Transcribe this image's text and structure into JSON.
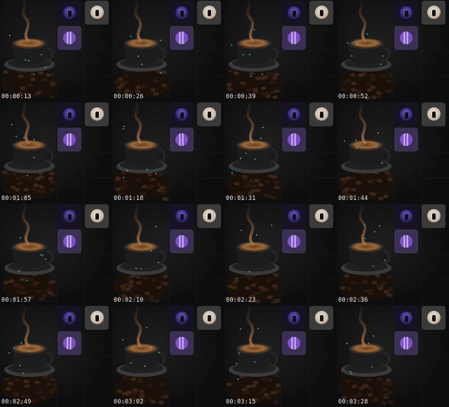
{
  "frames": [
    {
      "timestamp": "00:00:13"
    },
    {
      "timestamp": "00:00:26"
    },
    {
      "timestamp": "00:00:39"
    },
    {
      "timestamp": "00:00:52"
    },
    {
      "timestamp": "00:01:05"
    },
    {
      "timestamp": "00:01:18"
    },
    {
      "timestamp": "00:01:31"
    },
    {
      "timestamp": "00:01:44"
    },
    {
      "timestamp": "00:01:57"
    },
    {
      "timestamp": "00:02:10"
    },
    {
      "timestamp": "00:02:23"
    },
    {
      "timestamp": "00:02:36"
    },
    {
      "timestamp": "00:02:49"
    },
    {
      "timestamp": "00:03:02"
    },
    {
      "timestamp": "00:03:15"
    },
    {
      "timestamp": "00:03:28"
    }
  ],
  "colors": {
    "background": "#0a0a0a",
    "coffee_cup": "#1b1b1b",
    "saucer": "#2b2b2b",
    "beans": "#3a2418",
    "thumb_purple": "#3b2f52",
    "thumb_dark": "#161224",
    "thumb_gray": "#3a3a3a",
    "sparkle": "#3fd6c8"
  }
}
